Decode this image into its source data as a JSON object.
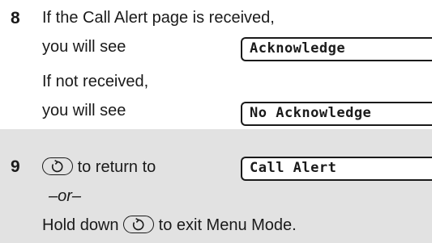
{
  "steps": [
    {
      "number": "8",
      "received_line1": "If the Call Alert page is received,",
      "received_line2": "you will see",
      "received_display": "Acknowledge",
      "not_received_line1": "If not received,",
      "not_received_line2": "you will see",
      "not_received_display": "No Acknowledge"
    },
    {
      "number": "9",
      "return_text": "to return to",
      "return_display": "Call Alert",
      "or_text": "–or–",
      "hold_text_before": "Hold down",
      "hold_text_after": "to exit Menu Mode."
    }
  ],
  "icons": {
    "menu_key": "menu-key-icon"
  },
  "colors": {
    "step9_background": "#e2e2e2",
    "text": "#1a1a1a"
  }
}
